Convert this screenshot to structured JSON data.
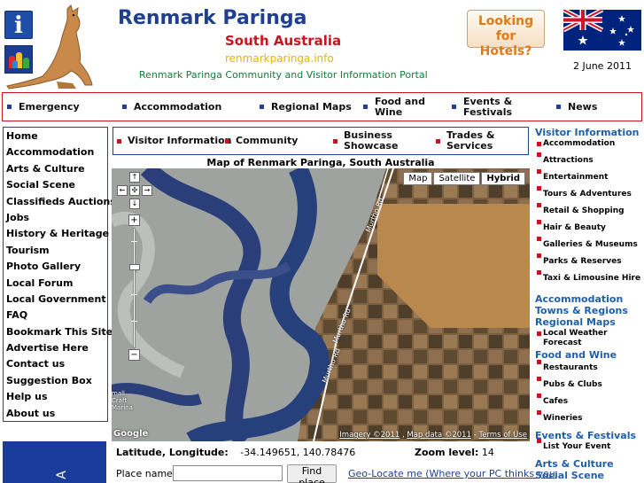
{
  "header": {
    "site_title": "Renmark Paringa",
    "state": "South Australia",
    "url": "renmarkparinga.info",
    "tagline": "Renmark Paringa Community and Visitor Information Portal",
    "info_glyph": "i",
    "hotels_button": "Looking for Hotels?",
    "date": "2 June 2011"
  },
  "top_nav": [
    "Emergency",
    "Accommodation",
    "Regional Maps",
    "Food and Wine",
    "Events & Festivals",
    "News"
  ],
  "left_nav": [
    "Home",
    "Accommodation",
    "Arts & Culture",
    "Social Scene",
    "Classifieds Auctions",
    "Jobs",
    "History & Heritage",
    "Tourism",
    "Photo Gallery",
    "Local Forum",
    "Local Government",
    "FAQ",
    "Bookmark This Site",
    "Advertise Here",
    "Contact us",
    "Suggestion Box",
    "Help us",
    "About us"
  ],
  "left_ad_text": "A",
  "sub_nav": [
    "Visitor Information",
    "Community",
    "Business Showcase",
    "Trades & Services"
  ],
  "map": {
    "title": "Map of Renmark Paringa, South Australia",
    "types": [
      "Map",
      "Satellite",
      "Hybrid"
    ],
    "active_type": "Hybrid",
    "road_labels": [
      "Murtho Rd",
      "Murtho Rd",
      "Murtho Rd"
    ],
    "place_label": "mall Craft Marina",
    "google": "Google",
    "imagery": "Imagery ©2011",
    "map_data": "Map data ©2011",
    "terms": "Terms of Use"
  },
  "coords": {
    "label": "Latitude, Longitude:",
    "value": "-34.149651, 140.78476",
    "zoom_label": "Zoom level:",
    "zoom_value": "14"
  },
  "place_search": {
    "label": "Place name:",
    "value": "",
    "button": "Find place",
    "geo_link": "Geo-Locate me (Where your PC thinks you"
  },
  "right_col": [
    {
      "type": "hd",
      "text": "Visitor Information"
    },
    {
      "type": "sub",
      "text": "Accommodation",
      "inline": true
    },
    {
      "type": "sub",
      "text": "Attractions"
    },
    {
      "type": "sub",
      "text": "Entertainment"
    },
    {
      "type": "sub",
      "text": "Tours & Adventures"
    },
    {
      "type": "sub",
      "text": "Retail & Shopping"
    },
    {
      "type": "sub",
      "text": "Hair & Beauty"
    },
    {
      "type": "sub",
      "text": "Galleries & Museums"
    },
    {
      "type": "sub",
      "text": "Parks & Reserves"
    },
    {
      "type": "sub",
      "text": "Taxi & Limousine Hire"
    },
    {
      "type": "hd",
      "text": "Accommodation"
    },
    {
      "type": "hd",
      "text": "Towns & Regions"
    },
    {
      "type": "hd",
      "text": "Regional Maps"
    },
    {
      "type": "sub",
      "text": "Local Weather Forecast",
      "inline": true
    },
    {
      "type": "hd",
      "text": "Food and Wine"
    },
    {
      "type": "sub",
      "text": "Restaurants"
    },
    {
      "type": "sub",
      "text": "Pubs & Clubs"
    },
    {
      "type": "sub",
      "text": "Cafes"
    },
    {
      "type": "sub",
      "text": "Wineries"
    },
    {
      "type": "hd",
      "text": "Events & Festivals"
    },
    {
      "type": "sub",
      "text": "List Your Event"
    },
    {
      "type": "hd",
      "text": "Arts & Culture"
    },
    {
      "type": "hd",
      "text": "Social Scene"
    }
  ],
  "colors": {
    "brand_blue": "#1f3f8f",
    "brand_red": "#c8141e",
    "link_blue": "#1f5fa8"
  }
}
